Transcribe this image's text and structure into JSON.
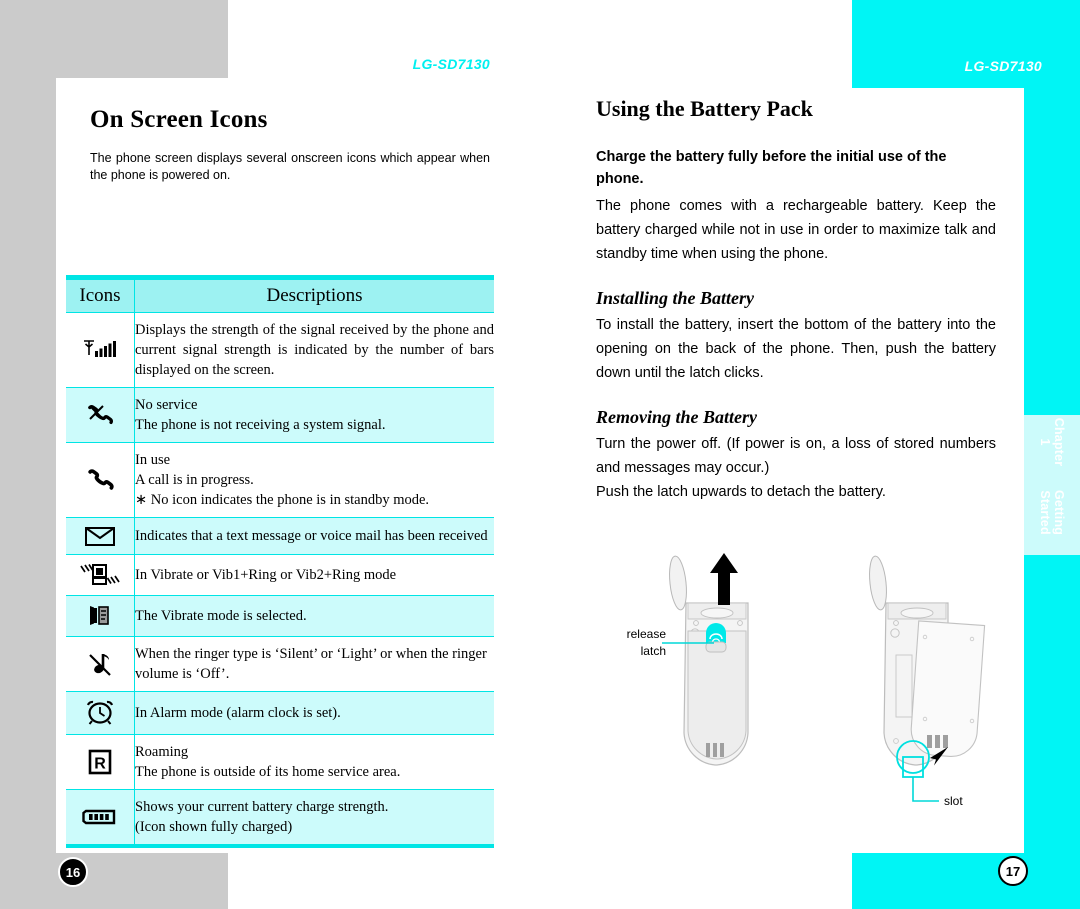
{
  "left_page": {
    "brand": "LG-SD7130",
    "title": "On Screen Icons",
    "intro": "The phone screen displays several onscreen icons which appear when the phone is powered on.",
    "table": {
      "headers": [
        "Icons",
        "Descriptions"
      ],
      "rows": [
        {
          "icon": "signal-strength-icon",
          "desc": "Displays the strength of the signal received by the phone and current signal strength is indicated by the number of bars displayed on the screen.",
          "shaded": false
        },
        {
          "icon": "no-service-icon",
          "desc_line1": "No service",
          "desc_line2": "The phone is not receiving a system signal.",
          "shaded": true
        },
        {
          "icon": "in-use-handset-icon",
          "desc_line1": "In use",
          "desc_line2": "A call is in progress.",
          "desc_line3": "∗ No icon indicates the phone is in standby mode.",
          "shaded": false
        },
        {
          "icon": "envelope-message-icon",
          "desc": "Indicates that a text message or voice mail has been received",
          "shaded": true
        },
        {
          "icon": "vibrate-ring-icon",
          "desc": "In Vibrate or Vib1+Ring or Vib2+Ring mode",
          "shaded": false
        },
        {
          "icon": "vibrate-mode-icon",
          "desc": "The Vibrate mode is selected.",
          "shaded": true
        },
        {
          "icon": "silent-note-icon",
          "desc": "When the ringer type is ‘Silent’ or ‘Light’ or when the ringer volume is ‘Off’.",
          "shaded": false
        },
        {
          "icon": "alarm-clock-icon",
          "desc": "In Alarm mode (alarm clock is set).",
          "shaded": true
        },
        {
          "icon": "roaming-r-icon",
          "desc_line1": "Roaming",
          "desc_line2": "The phone is outside of its home service area.",
          "shaded": false
        },
        {
          "icon": "battery-icon",
          "desc_line1": "Shows your current battery charge strength.",
          "desc_line2": "(Icon shown fully charged)",
          "shaded": true
        }
      ]
    },
    "page_number": "16"
  },
  "right_page": {
    "brand": "LG-SD7130",
    "title": "Using the Battery Pack",
    "lead_bold": "Charge the battery fully before the initial use of the phone.",
    "lead_body": "The phone comes with a rechargeable battery. Keep the battery charged while not in use in order to maximize talk and standby time when using the phone.",
    "section_installing": {
      "heading": "Installing the Battery",
      "body": "To install the battery, insert the bottom of the battery into the opening on the back of the phone. Then, push the battery down until the latch clicks."
    },
    "section_removing": {
      "heading": "Removing the Battery",
      "body_line1": "Turn the power off. (If power is on, a loss of  stored numbers and messages may occur.)",
      "body_line2": "Push  the latch upwards to detach the battery."
    },
    "diagram": {
      "label_release": "release",
      "label_latch": "latch",
      "label_slot": "slot"
    },
    "side_tab": {
      "line1": "Chapter 1",
      "line2": "Getting Started"
    },
    "page_number": "17"
  },
  "colors": {
    "cyan": "#00f5f5",
    "cyan_light": "#ccfbfb",
    "cyan_header": "#9df2f2",
    "cyan_rule": "#00e5e5",
    "gray": "#cbcbcb"
  }
}
